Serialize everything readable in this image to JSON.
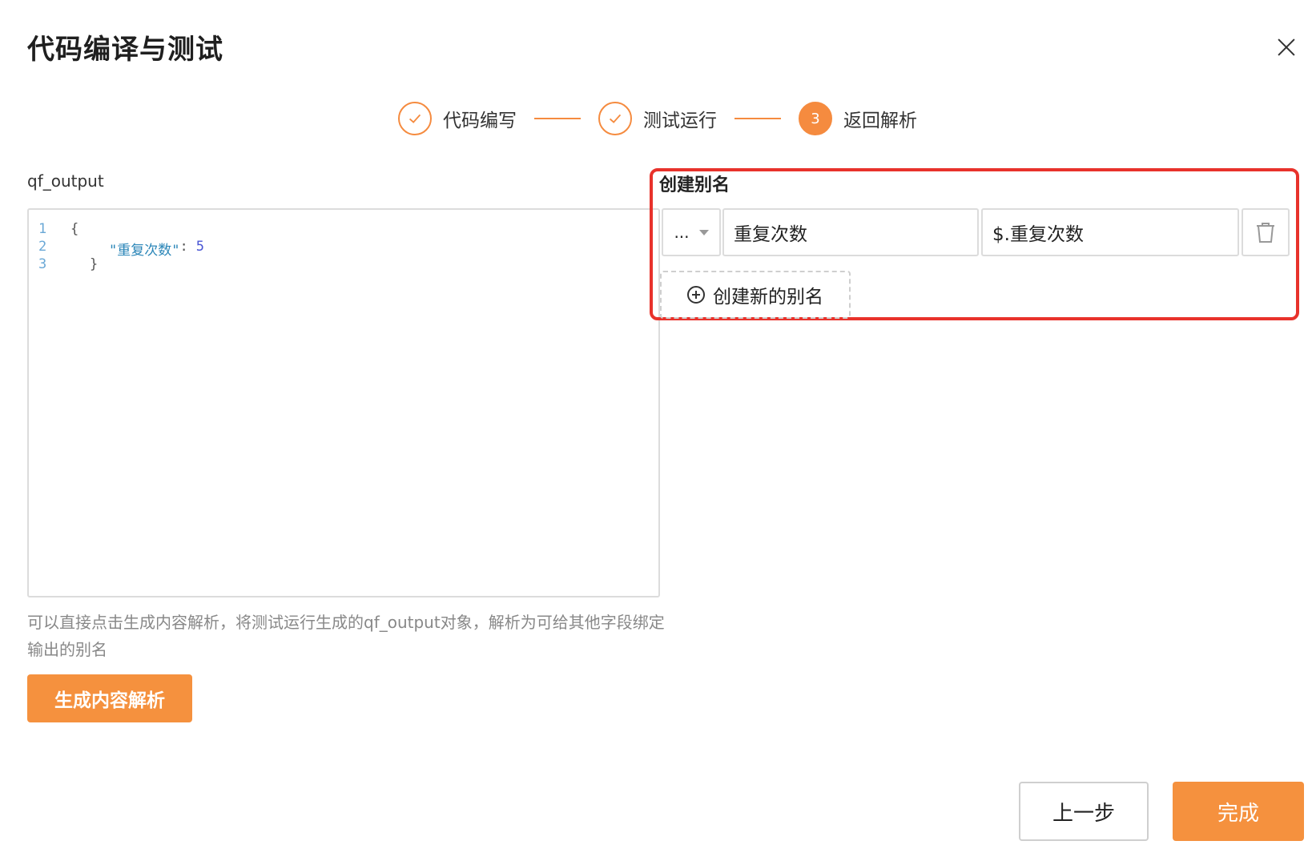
{
  "dialog": {
    "title": "代码编译与测试"
  },
  "steps": [
    {
      "label": "代码编写",
      "status": "done"
    },
    {
      "label": "测试运行",
      "status": "done"
    },
    {
      "label": "返回解析",
      "status": "active",
      "number": "3"
    }
  ],
  "left_panel": {
    "label": "qf_output",
    "code": {
      "line_numbers": [
        "1",
        "2",
        "3"
      ],
      "open_brace": "{",
      "key": "\"重复次数\"",
      "colon": ":",
      "value": "5",
      "close_brace": "}"
    },
    "help_text": "可以直接点击生成内容解析，将测试运行生成的qf_output对象，解析为可给其他字段绑定输出的别名",
    "generate_button": "生成内容解析"
  },
  "right_panel": {
    "title": "创建别名",
    "alias_rows": [
      {
        "type_select": "...",
        "name": "重复次数",
        "path": "$.重复次数"
      }
    ],
    "add_alias_button": "创建新的别名"
  },
  "footer": {
    "prev_button": "上一步",
    "finish_button": "完成"
  },
  "colors": {
    "accent": "#f5913e",
    "highlight": "#e8322b"
  }
}
